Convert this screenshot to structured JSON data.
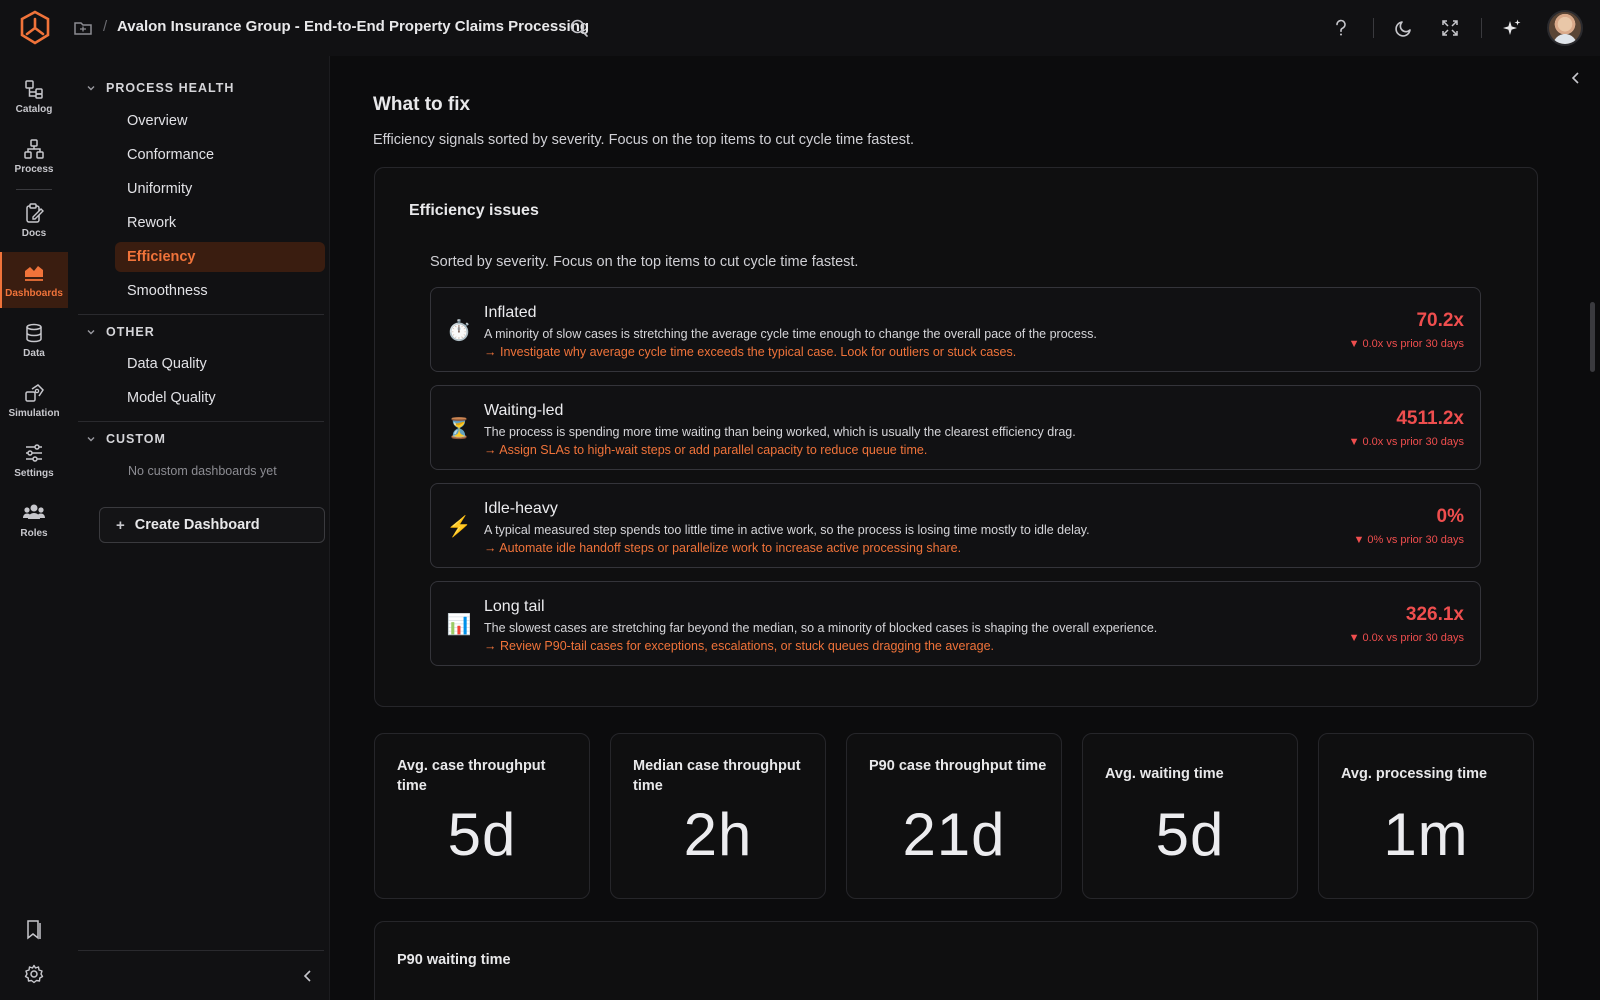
{
  "header": {
    "title": "Avalon Insurance Group - End-to-End Property Claims Processing",
    "separator": "/"
  },
  "rail": {
    "items": [
      {
        "label": "Catalog",
        "icon": "catalog-icon"
      },
      {
        "label": "Process",
        "icon": "process-icon"
      },
      {
        "label": "Docs",
        "icon": "docs-icon"
      },
      {
        "label": "Dashboards",
        "icon": "dashboards-icon",
        "active": true
      },
      {
        "label": "Data",
        "icon": "database-icon"
      },
      {
        "label": "Simulation",
        "icon": "simulation-icon"
      },
      {
        "label": "Settings",
        "icon": "sliders-icon"
      },
      {
        "label": "Roles",
        "icon": "users-icon"
      }
    ]
  },
  "nav": {
    "sections": [
      {
        "title": "PROCESS HEALTH",
        "items": [
          "Overview",
          "Conformance",
          "Uniformity",
          "Rework",
          "Efficiency",
          "Smoothness"
        ],
        "active": "Efficiency"
      },
      {
        "title": "OTHER",
        "items": [
          "Data Quality",
          "Model Quality"
        ]
      },
      {
        "title": "CUSTOM",
        "empty": "No custom dashboards yet"
      }
    ],
    "create_label": "Create Dashboard"
  },
  "main": {
    "title": "What to fix",
    "subtitle": "Efficiency signals sorted by severity. Focus on the top items to cut cycle time fastest.",
    "efficiency": {
      "title": "Efficiency issues",
      "subtitle": "Sorted by severity. Focus on the top items to cut cycle time fastest.",
      "issues": [
        {
          "icon": "⏱️",
          "icon_name": "stopwatch-icon",
          "name": "Inflated",
          "desc": "A minority of slow cases is stretching the average cycle time enough to change the overall pace of the process.",
          "action": "→ Investigate why average cycle time exceeds the typical case. Look for outliers or stuck cases.",
          "value": "70.2x",
          "delta": "▼ 0.0x vs prior 30 days"
        },
        {
          "icon": "⏳",
          "icon_name": "hourglass-icon",
          "name": "Waiting-led",
          "desc": "The process is spending more time waiting than being worked, which is usually the clearest efficiency drag.",
          "action": "→ Assign SLAs to high-wait steps or add parallel capacity to reduce queue time.",
          "value": "4511.2x",
          "delta": "▼ 0.0x vs prior 30 days"
        },
        {
          "icon": "⚡",
          "icon_name": "lightning-icon",
          "name": "Idle-heavy",
          "desc": "A typical measured step spends too little time in active work, so the process is losing time mostly to idle delay.",
          "action": "→ Automate idle handoff steps or parallelize work to increase active processing share.",
          "value": "0%",
          "delta": "▼ 0% vs prior 30 days"
        },
        {
          "icon": "📊",
          "icon_name": "bar-chart-icon",
          "name": "Long tail",
          "desc": "The slowest cases are stretching far beyond the median, so a minority of blocked cases is shaping the overall experience.",
          "action": "→ Review P90-tail cases for exceptions, escalations, or stuck queues dragging the average.",
          "value": "326.1x",
          "delta": "▼ 0.0x vs prior 30 days"
        }
      ]
    },
    "metrics": [
      {
        "label": "Avg. case throughput time",
        "value": "5d"
      },
      {
        "label": "Median case throughput time",
        "value": "2h"
      },
      {
        "label": "P90 case throughput time",
        "value": "21d"
      },
      {
        "label": "Avg. waiting time",
        "value": "5d"
      },
      {
        "label": "Avg. processing time",
        "value": "1m"
      }
    ],
    "p90_waiting_title": "P90 waiting time"
  },
  "colors": {
    "accent": "#f0733a",
    "danger": "#ef4e4e",
    "background": "#0c0c0d"
  }
}
